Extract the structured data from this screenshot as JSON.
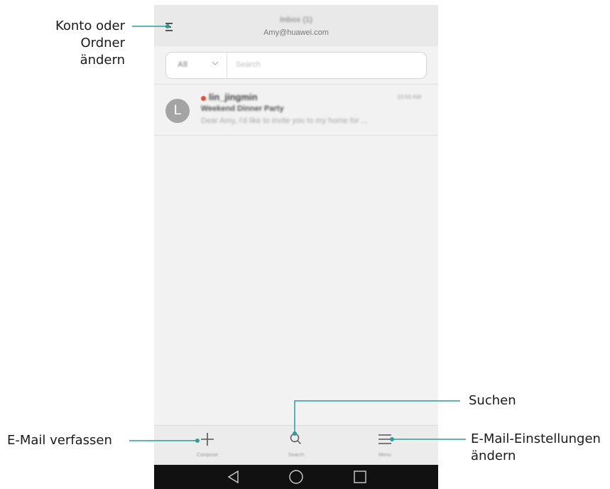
{
  "header": {
    "title": "Inbox (1)",
    "account_email": "Amy@huawei.com",
    "drawer_icon": "hamburger-menu-icon"
  },
  "search": {
    "filter_value": "All",
    "placeholder": "Search"
  },
  "messages": [
    {
      "avatar_letter": "L",
      "sender": "lin_jingmin",
      "time": "10:50 AM",
      "subject": "Weekend Dinner Party",
      "snippet": "Dear Amy,  I'd like to invite you to my home for ...",
      "unread": true
    }
  ],
  "toolbar": {
    "compose_label": "Compose",
    "search_label": "Search",
    "menu_label": "Menu"
  },
  "callouts": {
    "account_line1": "Konto oder",
    "account_line2": "Ordner ändern",
    "compose": "E-Mail verfassen",
    "search": "Suchen",
    "settings_line1": "E-Mail-Einstellungen",
    "settings_line2": "ändern"
  },
  "colors": {
    "accent_line": "#2a9d95",
    "unread_dot": "#e84a3c"
  }
}
